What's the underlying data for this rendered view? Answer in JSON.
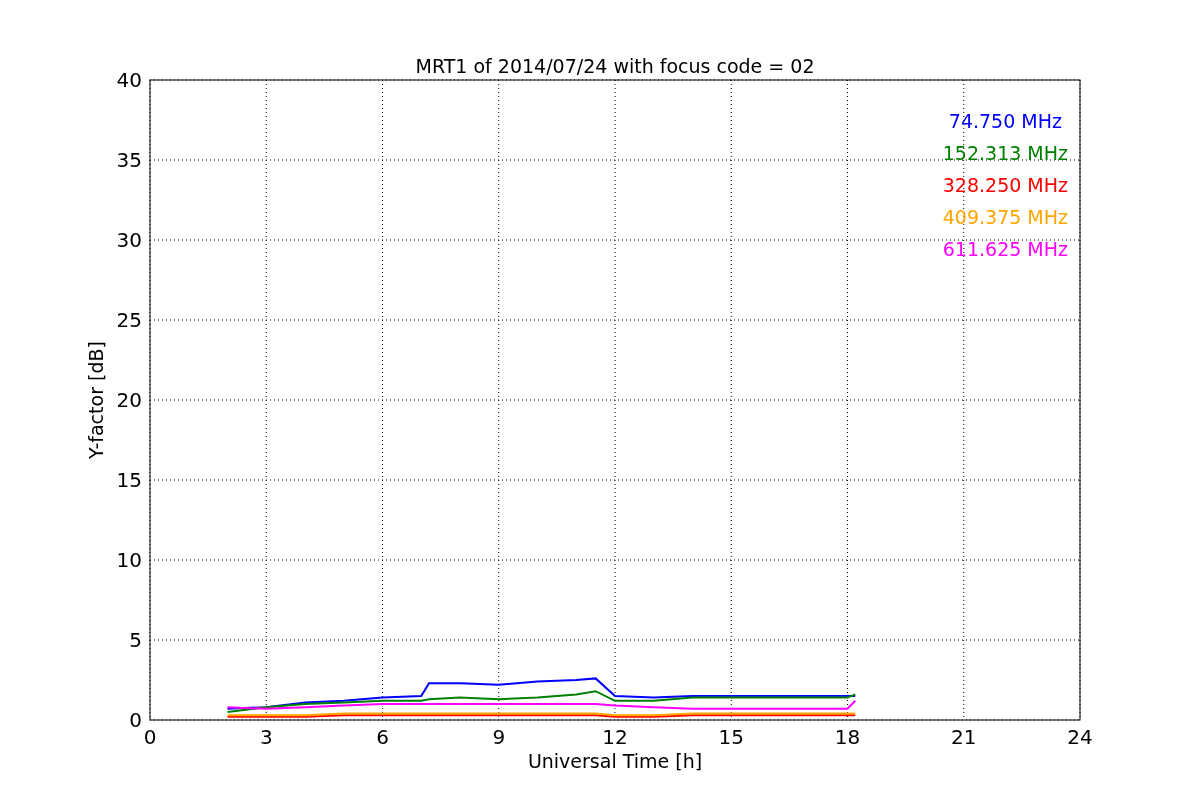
{
  "chart_data": {
    "type": "line",
    "title": "MRT1 of 2014/07/24 with focus code = 02",
    "xlabel": "Universal Time [h]",
    "ylabel": "Y-factor [dB]",
    "x": [
      2,
      3,
      4,
      5,
      6,
      7,
      7.2,
      8,
      9,
      10,
      11,
      11.5,
      12,
      13,
      14,
      18,
      18.2
    ],
    "series": [
      {
        "name": "74.750 MHz",
        "color": "#0000ff",
        "values": [
          0.7,
          0.8,
          1.1,
          1.2,
          1.4,
          1.5,
          2.3,
          2.3,
          2.2,
          2.4,
          2.5,
          2.6,
          1.5,
          1.4,
          1.5,
          1.5,
          1.5
        ]
      },
      {
        "name": "152.313 MHz",
        "color": "#008000",
        "values": [
          0.5,
          0.8,
          1.0,
          1.1,
          1.2,
          1.2,
          1.3,
          1.4,
          1.3,
          1.4,
          1.6,
          1.8,
          1.2,
          1.2,
          1.4,
          1.4,
          1.6
        ]
      },
      {
        "name": "328.250 MHz",
        "color": "#ff0000",
        "values": [
          0.2,
          0.2,
          0.2,
          0.3,
          0.3,
          0.3,
          0.3,
          0.3,
          0.3,
          0.3,
          0.3,
          0.3,
          0.2,
          0.2,
          0.3,
          0.3,
          0.3
        ]
      },
      {
        "name": "409.375 MHz",
        "color": "#ffa500",
        "values": [
          0.3,
          0.3,
          0.3,
          0.4,
          0.4,
          0.4,
          0.4,
          0.4,
          0.4,
          0.4,
          0.4,
          0.4,
          0.3,
          0.3,
          0.4,
          0.4,
          0.4
        ]
      },
      {
        "name": "611.625 MHz",
        "color": "#ff00ff",
        "values": [
          0.8,
          0.7,
          0.8,
          0.9,
          1.0,
          1.0,
          1.0,
          1.0,
          1.0,
          1.0,
          1.0,
          1.0,
          0.9,
          0.8,
          0.7,
          0.7,
          1.2
        ]
      }
    ],
    "xlim": [
      0,
      24
    ],
    "ylim": [
      0,
      40
    ],
    "xticks": [
      0,
      3,
      6,
      9,
      12,
      15,
      18,
      21,
      24
    ],
    "yticks": [
      0,
      5,
      10,
      15,
      20,
      25,
      30,
      35,
      40
    ],
    "grid": true
  }
}
